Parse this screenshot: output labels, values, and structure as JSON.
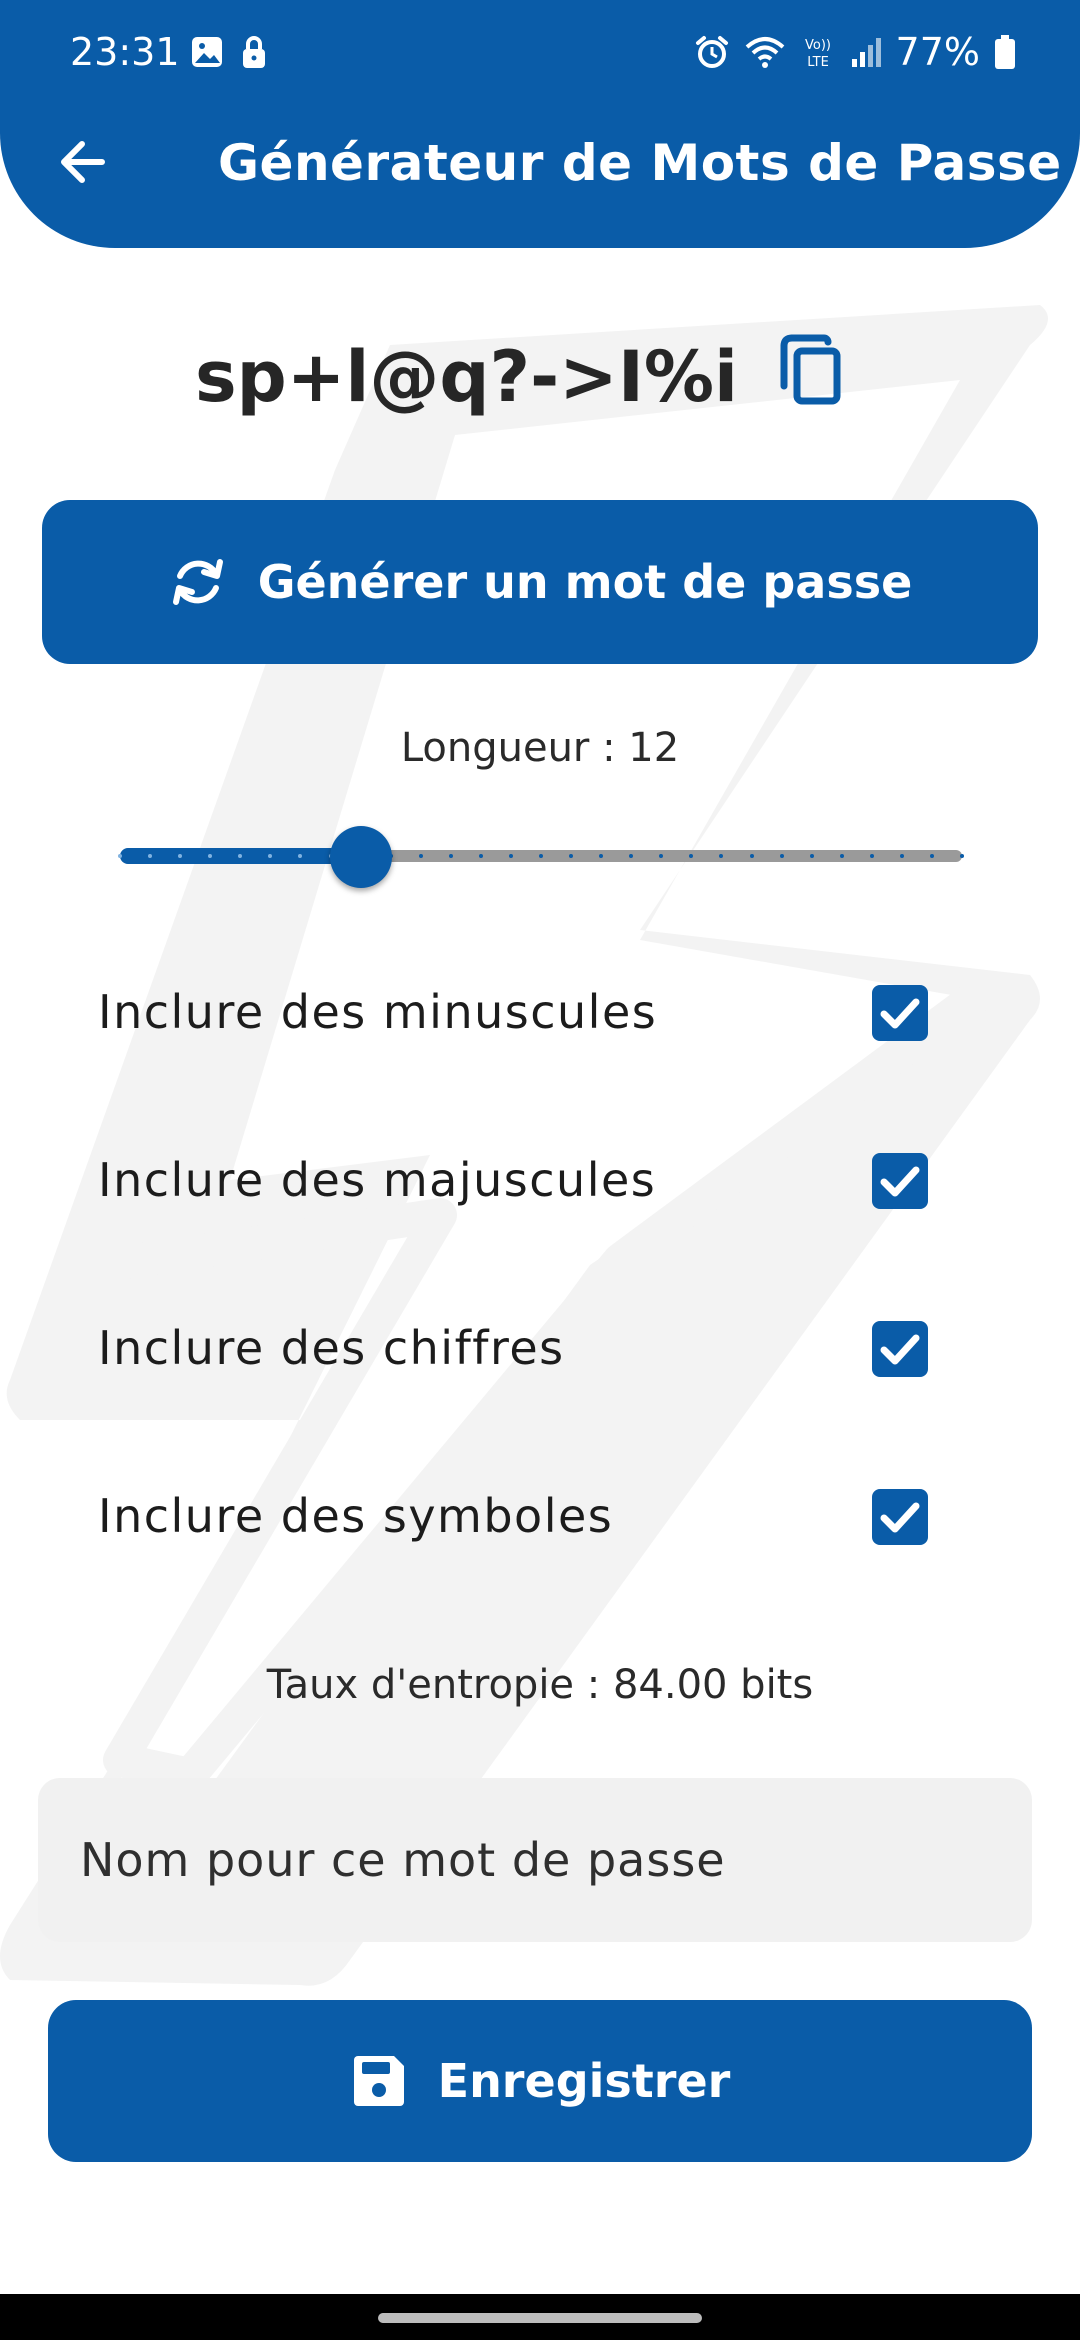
{
  "status_bar": {
    "time": "23:31",
    "battery": "77%",
    "icons": [
      "image-icon",
      "lock-icon",
      "alarm-icon",
      "wifi-icon",
      "volte-icon",
      "signal-icon",
      "battery-icon"
    ]
  },
  "header": {
    "title": "Générateur de Mots de Passe",
    "back_icon": "arrow-left-icon"
  },
  "password": {
    "value": "sp+l@q?->I%i",
    "copy_icon": "copy-icon"
  },
  "generate_button": {
    "label": "Générer un mot de passe",
    "icon": "refresh-icon"
  },
  "length": {
    "label": "Longueur : 12",
    "value": 12,
    "min": 4,
    "max": 32
  },
  "options": [
    {
      "label": "Inclure des minuscules",
      "checked": true
    },
    {
      "label": "Inclure des majuscules",
      "checked": true
    },
    {
      "label": "Inclure des chiffres",
      "checked": true
    },
    {
      "label": "Inclure des symboles",
      "checked": true
    }
  ],
  "entropy": {
    "label": "Taux d'entropie : 84.00 bits"
  },
  "name_field": {
    "placeholder": "Nom pour ce mot de passe",
    "value": ""
  },
  "save_button": {
    "label": "Enregistrer",
    "icon": "save-icon"
  },
  "colors": {
    "primary": "#0a5ca8",
    "background": "#ffffff",
    "field": "#f1f1f1",
    "watermark": "#f2f2f2"
  }
}
